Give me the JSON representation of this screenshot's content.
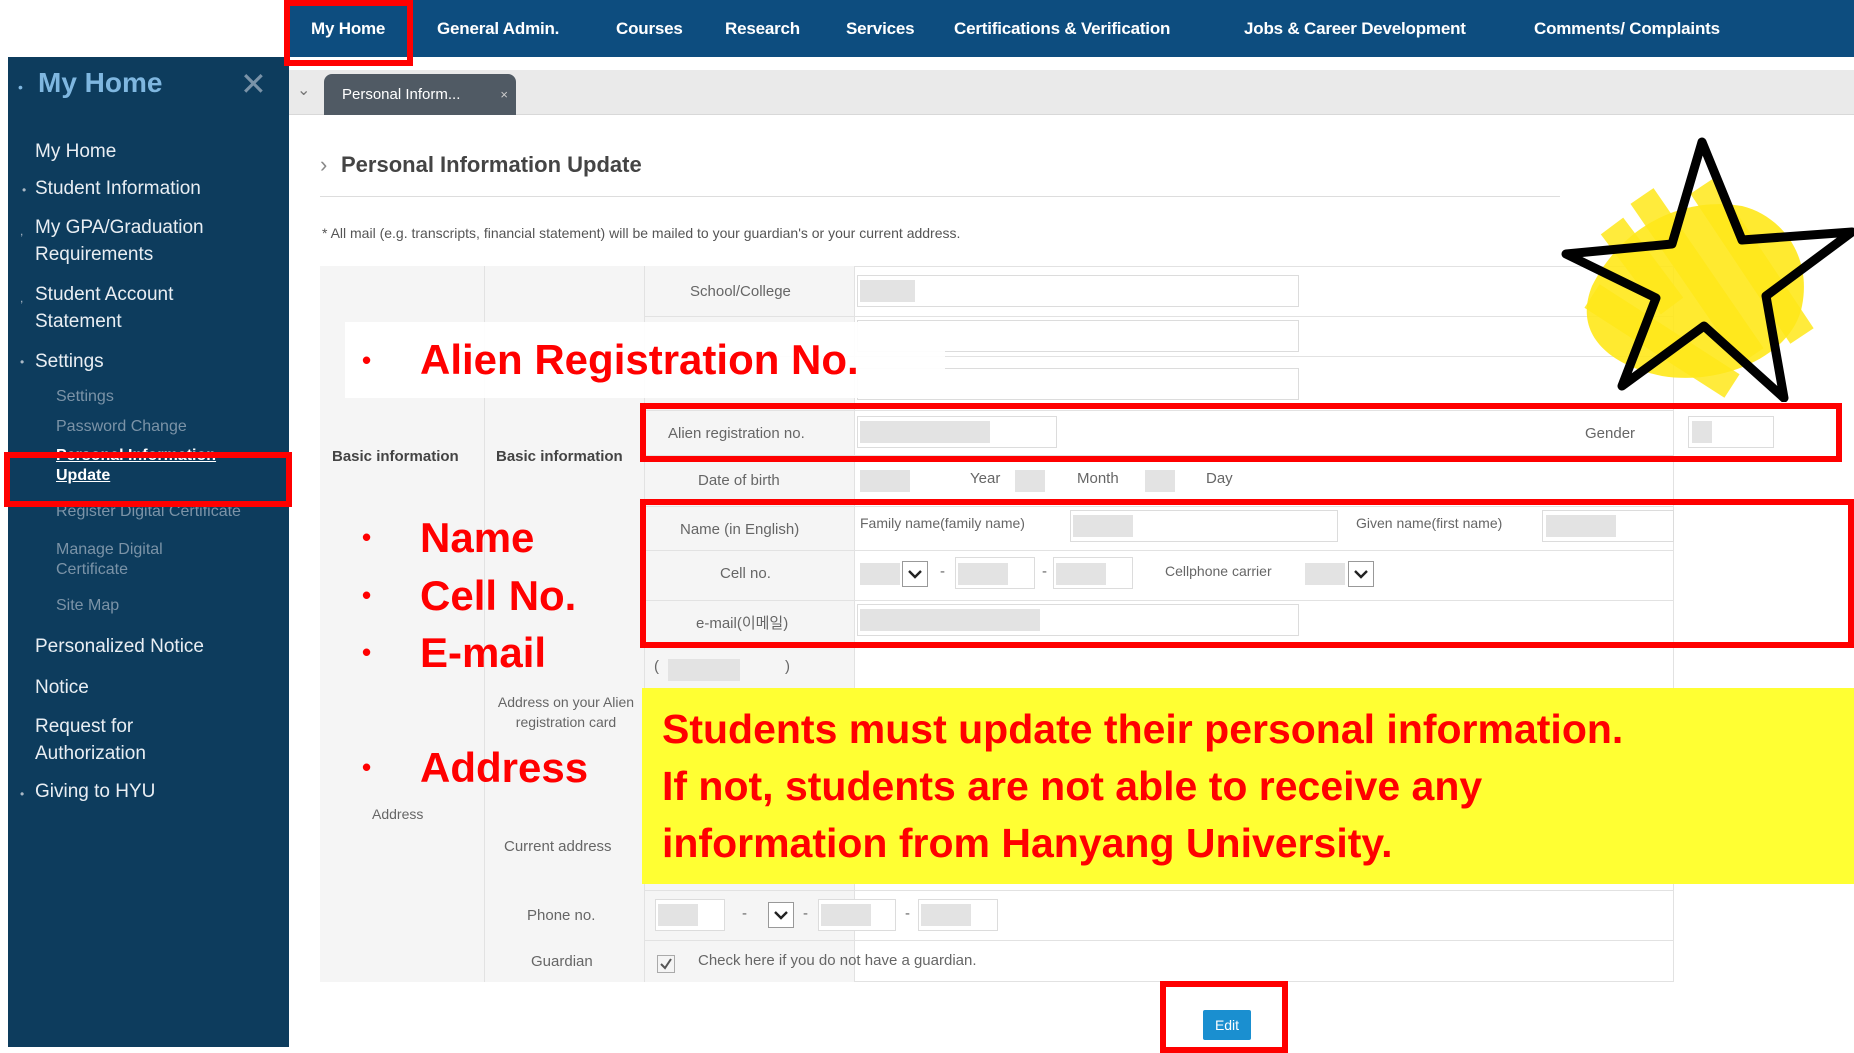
{
  "topnav": {
    "items": [
      "My Home",
      "General Admin.",
      "Courses",
      "Research",
      "Services",
      "Certifications & Verification",
      "Jobs & Career Development",
      "Comments/ Complaints"
    ]
  },
  "sidebar": {
    "title": "My Home",
    "items": [
      "My Home",
      "Student Information",
      "My GPA/Graduation Requirements",
      "Student Account Statement",
      "Settings"
    ],
    "settings_sub": [
      "Settings",
      "Password Change",
      "Personal Information Update",
      "Register Digital Certificate",
      "Manage Digital Certificate",
      "Site Map"
    ],
    "items_after": [
      "Personalized Notice",
      "Notice",
      "Request for Authorization",
      "Giving to HYU"
    ]
  },
  "tabbar": {
    "tab_label": "Personal Inform...",
    "tab_close": "×"
  },
  "page": {
    "title": "Personal Information Update",
    "notice": "* All mail (e.g. transcripts, financial statement) will be mailed to your guardian's or your current address."
  },
  "form": {
    "group_basic_1": "Basic information",
    "group_basic_2": "Basic information",
    "group_address": "Address",
    "school_college_label": "School/College",
    "alien_reg_label": "Alien registration no.",
    "gender_label": "Gender",
    "dob_label": "Date of birth",
    "dob_year": "Year",
    "dob_month": "Month",
    "dob_day": "Day",
    "name_label": "Name (in English)",
    "family_name_label": "Family name(family name)",
    "given_name_label": "Given name(first name)",
    "cell_label": "Cell no.",
    "cell_sep_1": "-",
    "cell_sep_2": "-",
    "carrier_label": "Cellphone carrier",
    "email_label": "e-mail(이메일)",
    "address_alien_label": "Address on your Alien registration card",
    "paren_open": "(",
    "paren_close": ")",
    "current_address_label": "Current address",
    "phone_label": "Phone no.",
    "phone_sep_1": "-",
    "phone_sep_2": "-",
    "phone_sep_3": "-",
    "guardian_label": "Guardian",
    "guardian_check_text": "Check here if you do not have a guardian.",
    "edit_button": "Edit"
  },
  "annotations": {
    "bullet_alien": "Alien Registration No.",
    "bullet_name": "Name",
    "bullet_cell": "Cell No.",
    "bullet_email": "E-mail",
    "bullet_address": "Address",
    "bullet_char": "•",
    "notice_lines": [
      "Students must update their personal information.",
      "If not, students are not able to receive any",
      "information from Hanyang University."
    ]
  },
  "colors": {
    "nav_bg": "#0d4d7f",
    "sidebar_bg": "#0d3c5d",
    "highlight_red": "#ff0000",
    "notice_yellow": "#ffff33",
    "edit_blue": "#1a8fd0"
  }
}
